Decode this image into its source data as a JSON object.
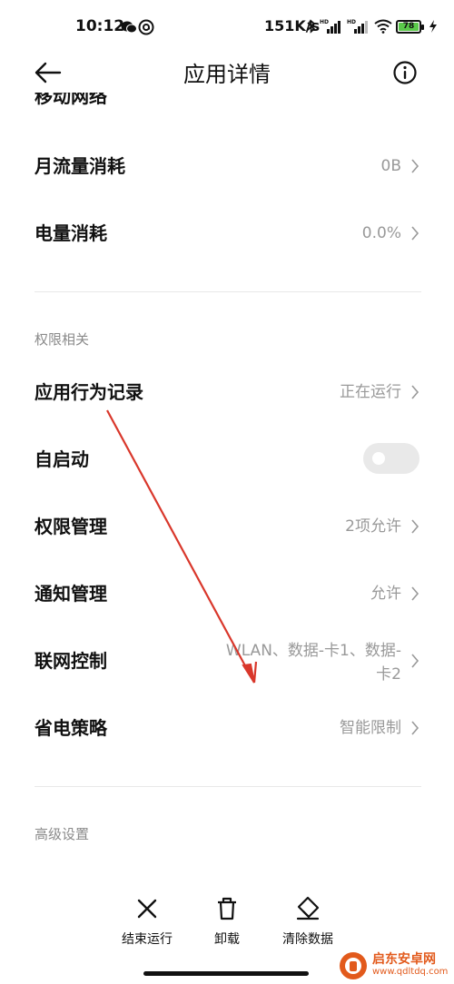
{
  "status_bar": {
    "time": "10:12",
    "net_speed": "151K/s",
    "battery_level": "78",
    "icons": [
      "wechat-icon",
      "at-circle-icon",
      "bluetooth-icon",
      "signal-hd-icon",
      "signal-hd-icon",
      "wifi-icon",
      "battery-icon",
      "charging-icon"
    ]
  },
  "header": {
    "title": "应用详情",
    "back_icon": "arrow-left-icon",
    "info_icon": "info-circle-icon"
  },
  "rows_top": [
    {
      "label": "月流量消耗",
      "value": "0B"
    },
    {
      "label": "电量消耗",
      "value": "0.0%"
    }
  ],
  "clipped_row_label": "移动网络",
  "permissions": {
    "header": "权限相关",
    "items": [
      {
        "label": "应用行为记录",
        "value": "正在运行"
      },
      {
        "label": "自启动",
        "value": "",
        "toggle": false
      },
      {
        "label": "权限管理",
        "value": "2项允许"
      },
      {
        "label": "通知管理",
        "value": "允许"
      },
      {
        "label": "联网控制",
        "value": "WLAN、数据-卡1、数据-卡2"
      },
      {
        "label": "省电策略",
        "value": "智能限制"
      }
    ]
  },
  "advanced": {
    "header": "高级设置"
  },
  "bottom_actions": [
    {
      "label": "结束运行",
      "icon": "close-x-icon"
    },
    {
      "label": "卸载",
      "icon": "trash-icon"
    },
    {
      "label": "清除数据",
      "icon": "eraser-icon"
    }
  ],
  "watermark": {
    "title": "启东安卓网",
    "url": "www.qdltdq.com"
  },
  "colors": {
    "annotation_arrow": "#d9372b",
    "secondary_text": "#999999",
    "battery_fill": "#5ac84a",
    "watermark": "#e25a1c"
  }
}
